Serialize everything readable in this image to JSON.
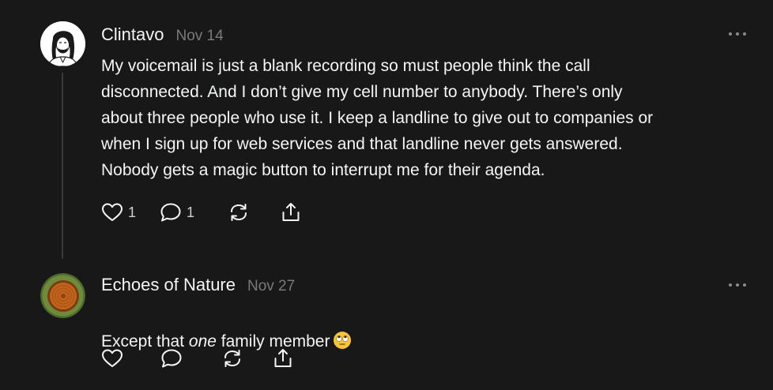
{
  "comments": [
    {
      "author": "Clintavo",
      "date": "Nov 14",
      "text": "My voicemail is just a blank recording so must people think the call\ndisconnected. And I don’t give my cell number to anybody. There’s only\nabout three people who use it. I keep a landline to give out to companies or\nwhen I sign up for web services and that landline never gets answered.\nNobody gets a magic button to interrupt me for their agenda.",
      "like_count": "1",
      "reply_count": "1",
      "avatar_icon": "portrait-sketch-avatar",
      "more_icon": "ellipsis-icon"
    },
    {
      "author": "Echoes of Nature",
      "date": "Nov 27",
      "text_before": "Except that ",
      "text_em": "one",
      "text_after": " family member",
      "emoji_icon": "eye-roll-emoji",
      "avatar_icon": "tree-rings-avatar",
      "more_icon": "ellipsis-icon"
    }
  ],
  "colors": {
    "background": "#181818",
    "text": "#f3f5f7",
    "muted": "#7a7a7a",
    "thread_line": "#3a3a3a"
  }
}
